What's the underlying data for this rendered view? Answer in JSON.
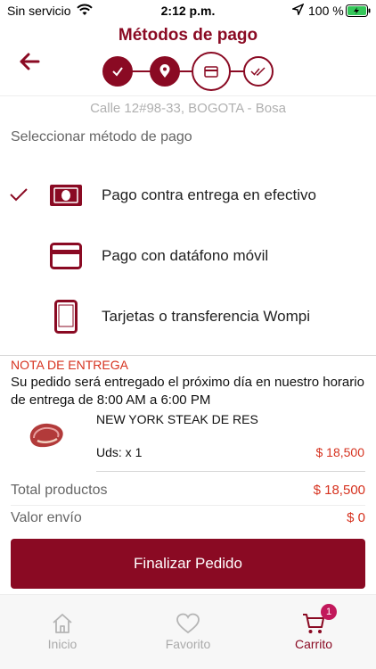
{
  "status_bar": {
    "carrier": "Sin servicio",
    "time": "2:12 p.m.",
    "battery_percent": "100 %"
  },
  "header": {
    "title": "Métodos de pago",
    "steps": [
      {
        "icon": "check-icon",
        "state": "done"
      },
      {
        "icon": "location-pin-icon",
        "state": "done"
      },
      {
        "icon": "card-icon",
        "state": "active"
      },
      {
        "icon": "double-check-icon",
        "state": "todo"
      }
    ]
  },
  "address": "Calle 12#98-33, BOGOTA - Bosa",
  "select_label": "Seleccionar método de pago",
  "payment_methods": [
    {
      "label": "Pago contra entrega en efectivo",
      "icon": "cash-icon",
      "selected": true
    },
    {
      "label": "Pago con datáfono móvil",
      "icon": "card-icon",
      "selected": false
    },
    {
      "label": "Tarjetas o transferencia Wompi",
      "icon": "phone-icon",
      "selected": false
    }
  ],
  "delivery_note": {
    "title": "NOTA DE ENTREGA",
    "text": "Su pedido será entregado el próximo día en nuestro horario de entrega de 8:00 AM a 6:00 PM"
  },
  "product": {
    "name": "NEW YORK STEAK DE RES",
    "quantity": "Uds: x 1",
    "price": "$ 18,500"
  },
  "summary": {
    "total_label": "Total productos",
    "total_value": "$ 18,500",
    "shipping_label": "Valor envío",
    "shipping_value": "$ 0"
  },
  "finish_button": "Finalizar Pedido",
  "tabs": [
    {
      "label": "Inicio",
      "icon": "home-icon",
      "active": false
    },
    {
      "label": "Favorito",
      "icon": "heart-icon",
      "active": false
    },
    {
      "label": "Carrito",
      "icon": "cart-icon",
      "active": true,
      "badge": "1"
    }
  ],
  "colors": {
    "brand": "#8a0a23",
    "price": "#d6321f",
    "badge": "#c2185b"
  }
}
